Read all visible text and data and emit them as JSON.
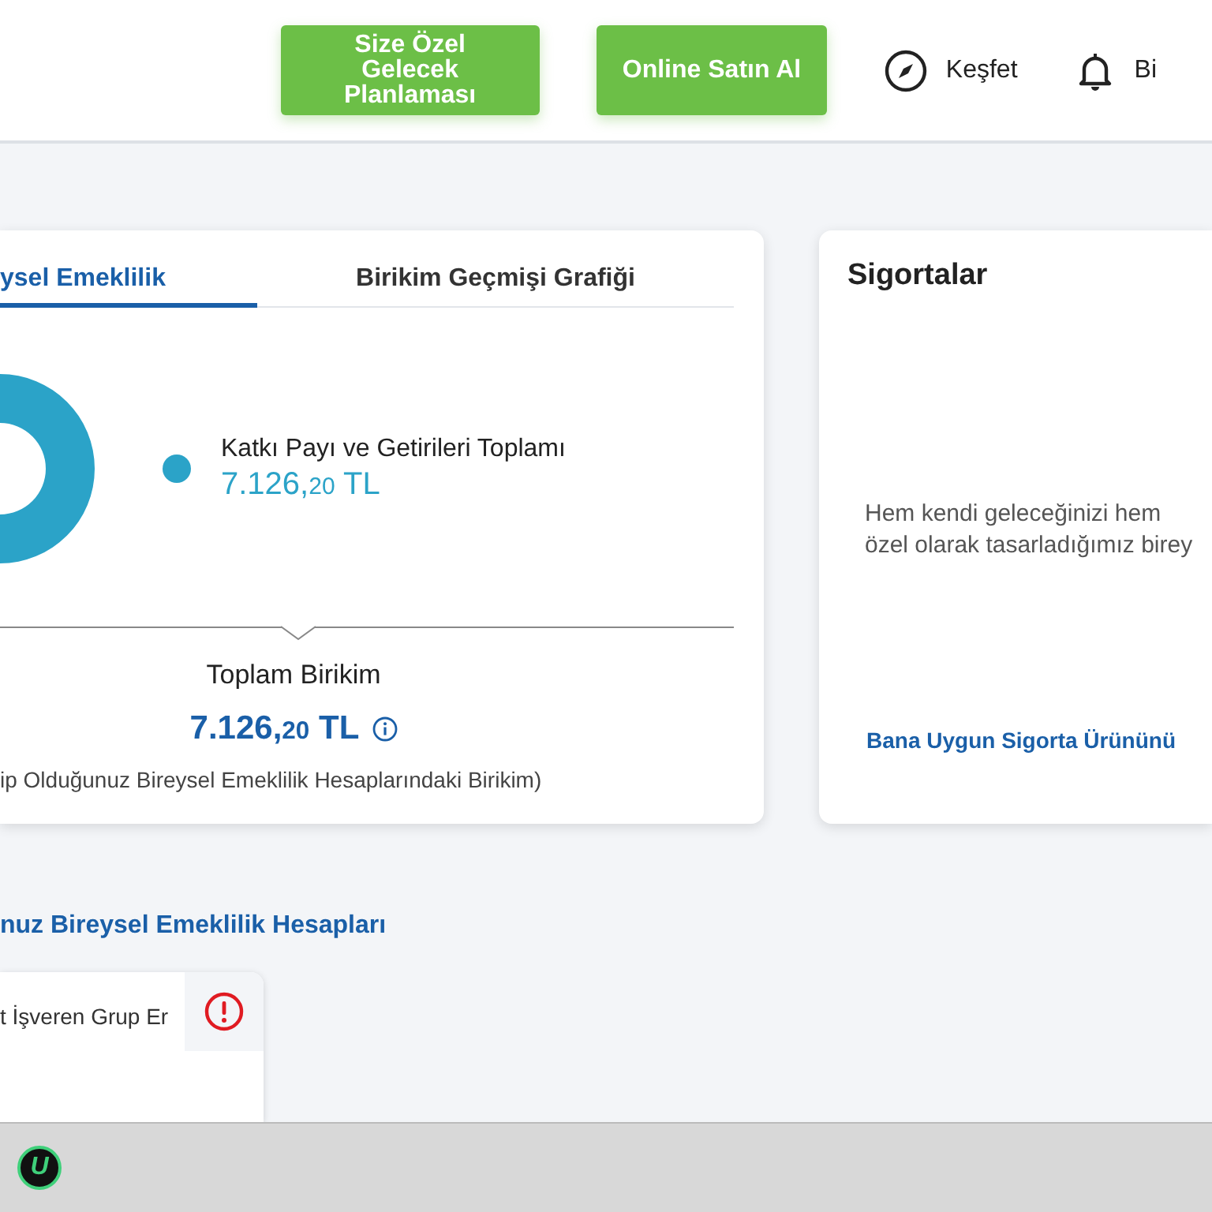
{
  "header": {
    "buttons": [
      {
        "label": "Size Özel Gelecek Planlaması"
      },
      {
        "label": "Online Satın Al"
      }
    ],
    "links": [
      {
        "kind": "compass",
        "label": "Keşfet"
      },
      {
        "kind": "bell",
        "label": "Bi"
      }
    ]
  },
  "savings_card": {
    "tabs": [
      {
        "label": "ysel Emeklilik",
        "selected": true
      },
      {
        "label": "Birikim Geçmişi Grafiği",
        "selected": false
      }
    ],
    "legend": [
      {
        "label": "Katkı Payı ve Getirileri Toplamı",
        "amount": "7.126,",
        "cents": "20",
        "currency": "TL",
        "color": "#2ba3c8"
      }
    ],
    "total_label": "Toplam Birikim",
    "total_amount": "7.126,",
    "total_cents": "20",
    "total_currency": "TL",
    "note": "ip Olduğunuz Bireysel Emeklilik Hesaplarındaki Birikim)"
  },
  "insurance_card": {
    "title": "Sigortalar",
    "text_lines": [
      "Hem kendi geleceğinizi hem",
      "özel olarak tasarladığımız birey"
    ],
    "link": "Bana Uygun Sigorta Ürününü"
  },
  "accounts": {
    "title": "nuz Bireysel Emeklilik Hesapları",
    "items": [
      {
        "name": "t İşveren Grup Er",
        "warning": true
      }
    ]
  },
  "taskbar": {
    "logo_letter": "U"
  }
}
